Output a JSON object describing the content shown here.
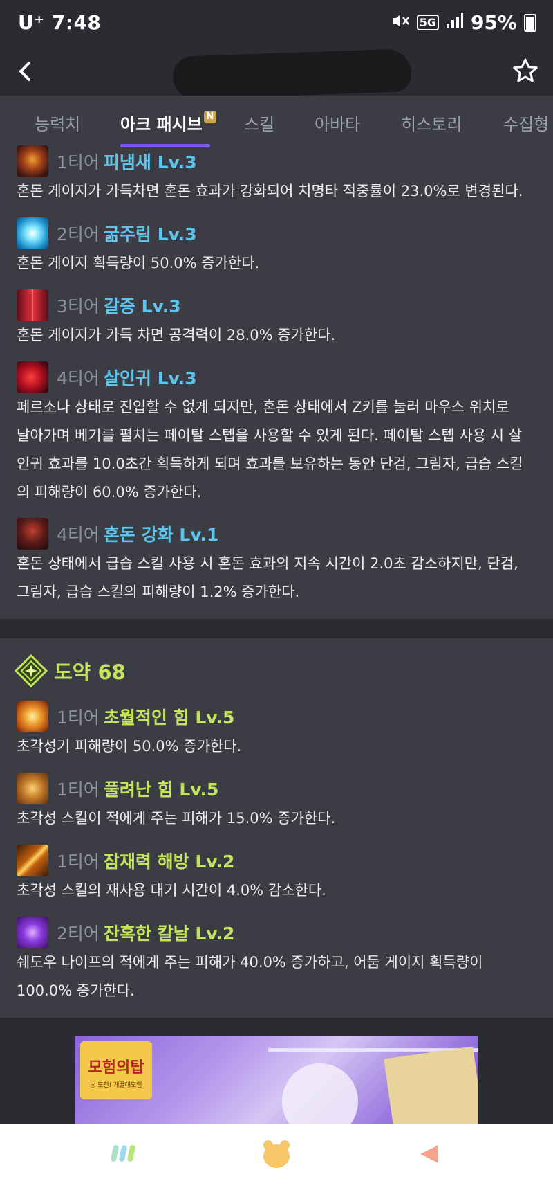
{
  "status_bar": {
    "carrier_time": "U⁺ 7:48",
    "network": "5G",
    "battery": "95%"
  },
  "header": {
    "back_icon": "chevron-left-icon",
    "favorite_icon": "star-outline-icon"
  },
  "tabs": [
    {
      "label": "능력치",
      "active": false
    },
    {
      "label": "아크 패시브",
      "active": true,
      "badge": "N"
    },
    {
      "label": "스킬",
      "active": false
    },
    {
      "label": "아바타",
      "active": false
    },
    {
      "label": "히스토리",
      "active": false
    },
    {
      "label": "수집형",
      "active": false
    }
  ],
  "chaos_entries": [
    {
      "tier": "1티어",
      "name": "피냄새 Lv.3",
      "desc": [
        "혼돈 게이지가 가득차면 혼돈 효과가 강화되어 치명타 적중률이 23.0%로 변경된다."
      ]
    },
    {
      "tier": "2티어",
      "name": "굶주림 Lv.3",
      "desc": [
        "혼돈 게이지 획득량이 50.0% 증가한다."
      ]
    },
    {
      "tier": "3티어",
      "name": "갈증 Lv.3",
      "desc": [
        "혼돈 게이지가 가득 차면 공격력이 28.0% 증가한다."
      ]
    },
    {
      "tier": "4티어",
      "name": "살인귀 Lv.3",
      "desc": [
        "페르소나 상태로 진입할 수 없게 되지만, 혼돈 상태에서 Z키를 눌러 마우스 위치로",
        "날아가며 베기를 펼치는 페이탈 스텝을 사용할 수 있게 된다. 페이탈 스텝 사용 시 살",
        "인귀 효과를 10.0초간 획득하게 되며 효과를 보유하는 동안 단검, 그림자, 급습 스킬",
        "의 피해량이 60.0% 증가한다."
      ]
    },
    {
      "tier": "4티어",
      "name": "혼돈 강화 Lv.1",
      "desc": [
        "혼돈 상태에서 급습 스킬 사용 시 혼돈 효과의 지속 시간이 2.0초 감소하지만, 단검,",
        "그림자, 급습 스킬의 피해량이 1.2% 증가한다."
      ]
    }
  ],
  "leap_group": {
    "title": "도약 68",
    "icon": "leap-emblem-icon",
    "entries": [
      {
        "tier": "1티어",
        "name": "초월적인 힘 Lv.5",
        "desc": [
          "초각성기 피해량이 50.0% 증가한다."
        ]
      },
      {
        "tier": "1티어",
        "name": "풀려난 힘 Lv.5",
        "desc": [
          "초각성 스킬이 적에게 주는 피해가 15.0% 증가한다."
        ]
      },
      {
        "tier": "1티어",
        "name": "잠재력 해방 Lv.2",
        "desc": [
          "초각성 스킬의 재사용 대기 시간이 4.0% 감소한다."
        ]
      },
      {
        "tier": "2티어",
        "name": "잔혹한 칼날 Lv.2",
        "desc": [
          "쉐도우 나이프의 적에게 주는 피해가 40.0% 증가하고, 어둠 게이지 획득량이",
          "100.0% 증가한다."
        ]
      }
    ]
  },
  "ad": {
    "logo_title": "모험의탑",
    "logo_sub": "◎ 도전! 개꿀대모험"
  },
  "bottom_nav": [
    {
      "icon": "feed-stripes-icon"
    },
    {
      "icon": "bear-face-icon"
    },
    {
      "icon": "megaphone-icon"
    }
  ],
  "colors": {
    "background": "#2b2c32",
    "card": "#3b3c44",
    "accent_tab": "#7b5cf0",
    "chaos_name": "#5dc4ec",
    "leap_name": "#c6e25c",
    "tier_gray": "#8f929c"
  }
}
